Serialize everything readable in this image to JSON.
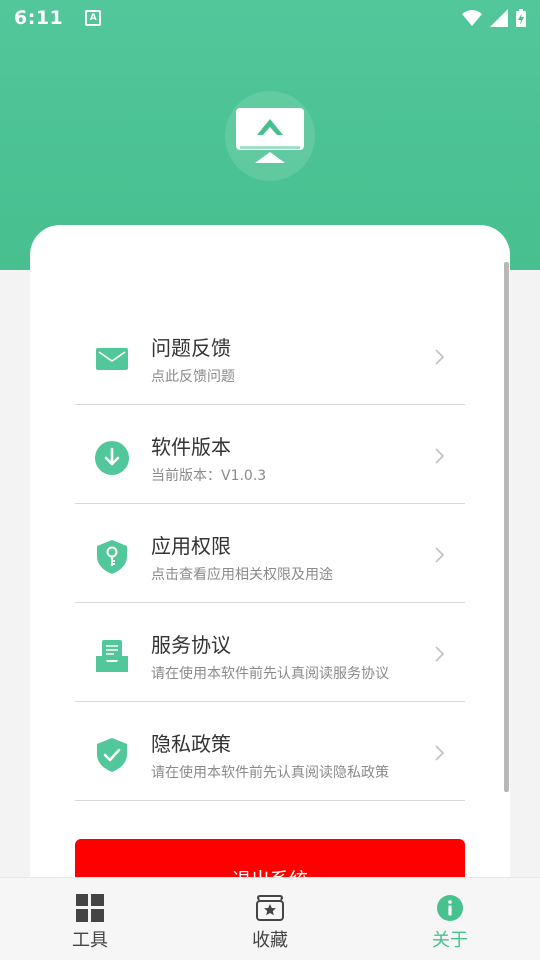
{
  "status_bar": {
    "time": "6:11",
    "app_badge": "A"
  },
  "menu": [
    {
      "title": "问题反馈",
      "subtitle": "点此反馈问题",
      "icon": "mail-icon"
    },
    {
      "title": "软件版本",
      "subtitle": "当前版本：V1.0.3",
      "icon": "download-icon"
    },
    {
      "title": "应用权限",
      "subtitle": "点击查看应用相关权限及用途",
      "icon": "shield-key-icon"
    },
    {
      "title": "服务协议",
      "subtitle": "请在使用本软件前先认真阅读服务协议",
      "icon": "document-tray-icon"
    },
    {
      "title": "隐私政策",
      "subtitle": "请在使用本软件前先认真阅读隐私政策",
      "icon": "shield-check-icon"
    }
  ],
  "logout_label": "退出系统",
  "nav": [
    {
      "label": "工具",
      "icon": "grid-icon",
      "active": false
    },
    {
      "label": "收藏",
      "icon": "folder-star-icon",
      "active": false
    },
    {
      "label": "关于",
      "icon": "info-icon",
      "active": true
    }
  ],
  "colors": {
    "accent": "#47c28f",
    "header": "#52c79b",
    "danger": "#ff0000"
  }
}
